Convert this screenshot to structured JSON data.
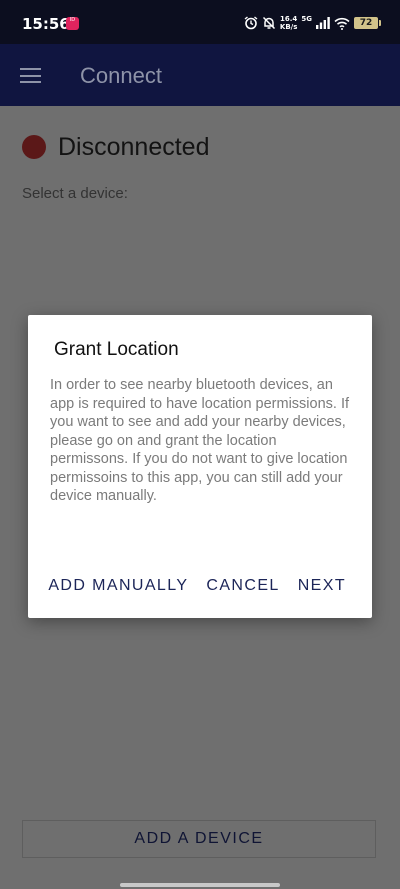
{
  "status_bar": {
    "time": "15:56",
    "notification_badge": "ID",
    "net_speed_value": "16.4",
    "net_speed_unit": "KB/s",
    "network": "5G",
    "battery": "72"
  },
  "app_bar": {
    "title": "Connect"
  },
  "connection": {
    "status": "Disconnected",
    "status_color": "#5b1818"
  },
  "device_select": {
    "label": "Select a device:"
  },
  "dialog": {
    "title": "Grant Location",
    "body": "In order to see nearby bluetooth devices, an app is required to have location permissions. If you want to see and add your nearby devices, please go on and grant the location permissons. If you do not want to give location permissoins to this app, you can still add your device manually.",
    "actions": {
      "add_manually": "ADD MANUALLY",
      "cancel": "CANCEL",
      "next": "NEXT"
    }
  },
  "footer": {
    "add_device": "ADD A DEVICE"
  }
}
